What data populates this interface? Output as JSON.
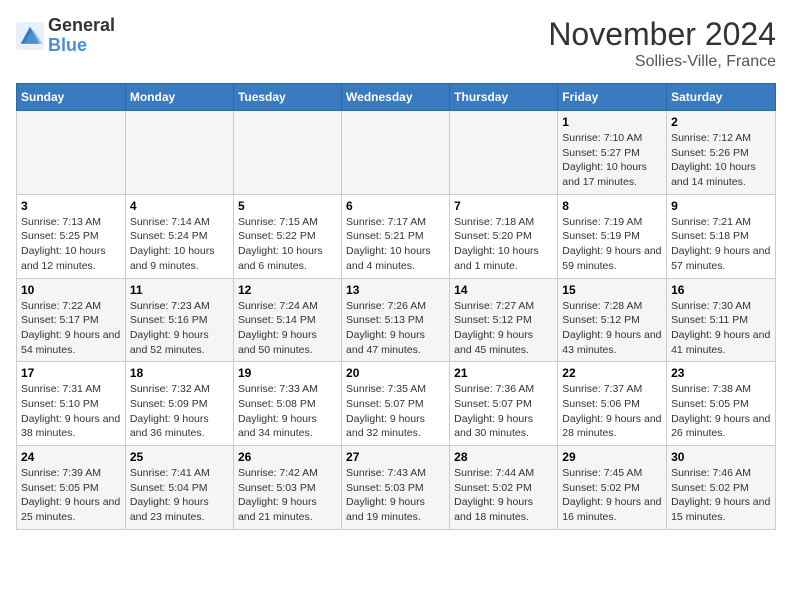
{
  "logo": {
    "general": "General",
    "blue": "Blue"
  },
  "title": "November 2024",
  "subtitle": "Sollies-Ville, France",
  "days_of_week": [
    "Sunday",
    "Monday",
    "Tuesday",
    "Wednesday",
    "Thursday",
    "Friday",
    "Saturday"
  ],
  "weeks": [
    [
      {
        "day": "",
        "info": ""
      },
      {
        "day": "",
        "info": ""
      },
      {
        "day": "",
        "info": ""
      },
      {
        "day": "",
        "info": ""
      },
      {
        "day": "",
        "info": ""
      },
      {
        "day": "1",
        "info": "Sunrise: 7:10 AM\nSunset: 5:27 PM\nDaylight: 10 hours and 17 minutes."
      },
      {
        "day": "2",
        "info": "Sunrise: 7:12 AM\nSunset: 5:26 PM\nDaylight: 10 hours and 14 minutes."
      }
    ],
    [
      {
        "day": "3",
        "info": "Sunrise: 7:13 AM\nSunset: 5:25 PM\nDaylight: 10 hours and 12 minutes."
      },
      {
        "day": "4",
        "info": "Sunrise: 7:14 AM\nSunset: 5:24 PM\nDaylight: 10 hours and 9 minutes."
      },
      {
        "day": "5",
        "info": "Sunrise: 7:15 AM\nSunset: 5:22 PM\nDaylight: 10 hours and 6 minutes."
      },
      {
        "day": "6",
        "info": "Sunrise: 7:17 AM\nSunset: 5:21 PM\nDaylight: 10 hours and 4 minutes."
      },
      {
        "day": "7",
        "info": "Sunrise: 7:18 AM\nSunset: 5:20 PM\nDaylight: 10 hours and 1 minute."
      },
      {
        "day": "8",
        "info": "Sunrise: 7:19 AM\nSunset: 5:19 PM\nDaylight: 9 hours and 59 minutes."
      },
      {
        "day": "9",
        "info": "Sunrise: 7:21 AM\nSunset: 5:18 PM\nDaylight: 9 hours and 57 minutes."
      }
    ],
    [
      {
        "day": "10",
        "info": "Sunrise: 7:22 AM\nSunset: 5:17 PM\nDaylight: 9 hours and 54 minutes."
      },
      {
        "day": "11",
        "info": "Sunrise: 7:23 AM\nSunset: 5:16 PM\nDaylight: 9 hours and 52 minutes."
      },
      {
        "day": "12",
        "info": "Sunrise: 7:24 AM\nSunset: 5:14 PM\nDaylight: 9 hours and 50 minutes."
      },
      {
        "day": "13",
        "info": "Sunrise: 7:26 AM\nSunset: 5:13 PM\nDaylight: 9 hours and 47 minutes."
      },
      {
        "day": "14",
        "info": "Sunrise: 7:27 AM\nSunset: 5:12 PM\nDaylight: 9 hours and 45 minutes."
      },
      {
        "day": "15",
        "info": "Sunrise: 7:28 AM\nSunset: 5:12 PM\nDaylight: 9 hours and 43 minutes."
      },
      {
        "day": "16",
        "info": "Sunrise: 7:30 AM\nSunset: 5:11 PM\nDaylight: 9 hours and 41 minutes."
      }
    ],
    [
      {
        "day": "17",
        "info": "Sunrise: 7:31 AM\nSunset: 5:10 PM\nDaylight: 9 hours and 38 minutes."
      },
      {
        "day": "18",
        "info": "Sunrise: 7:32 AM\nSunset: 5:09 PM\nDaylight: 9 hours and 36 minutes."
      },
      {
        "day": "19",
        "info": "Sunrise: 7:33 AM\nSunset: 5:08 PM\nDaylight: 9 hours and 34 minutes."
      },
      {
        "day": "20",
        "info": "Sunrise: 7:35 AM\nSunset: 5:07 PM\nDaylight: 9 hours and 32 minutes."
      },
      {
        "day": "21",
        "info": "Sunrise: 7:36 AM\nSunset: 5:07 PM\nDaylight: 9 hours and 30 minutes."
      },
      {
        "day": "22",
        "info": "Sunrise: 7:37 AM\nSunset: 5:06 PM\nDaylight: 9 hours and 28 minutes."
      },
      {
        "day": "23",
        "info": "Sunrise: 7:38 AM\nSunset: 5:05 PM\nDaylight: 9 hours and 26 minutes."
      }
    ],
    [
      {
        "day": "24",
        "info": "Sunrise: 7:39 AM\nSunset: 5:05 PM\nDaylight: 9 hours and 25 minutes."
      },
      {
        "day": "25",
        "info": "Sunrise: 7:41 AM\nSunset: 5:04 PM\nDaylight: 9 hours and 23 minutes."
      },
      {
        "day": "26",
        "info": "Sunrise: 7:42 AM\nSunset: 5:03 PM\nDaylight: 9 hours and 21 minutes."
      },
      {
        "day": "27",
        "info": "Sunrise: 7:43 AM\nSunset: 5:03 PM\nDaylight: 9 hours and 19 minutes."
      },
      {
        "day": "28",
        "info": "Sunrise: 7:44 AM\nSunset: 5:02 PM\nDaylight: 9 hours and 18 minutes."
      },
      {
        "day": "29",
        "info": "Sunrise: 7:45 AM\nSunset: 5:02 PM\nDaylight: 9 hours and 16 minutes."
      },
      {
        "day": "30",
        "info": "Sunrise: 7:46 AM\nSunset: 5:02 PM\nDaylight: 9 hours and 15 minutes."
      }
    ]
  ]
}
